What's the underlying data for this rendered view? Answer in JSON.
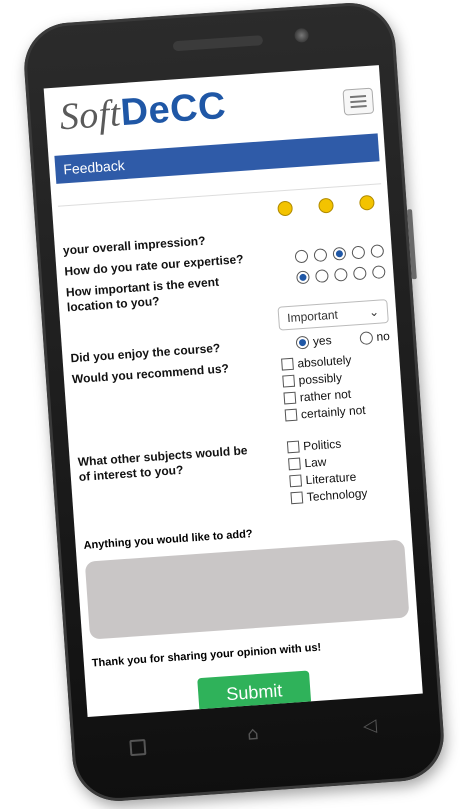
{
  "brand": {
    "soft": "Soft",
    "decc": "DeCC"
  },
  "menu": {
    "icon": "hamburger-icon"
  },
  "page": {
    "section_title": "Feedback"
  },
  "ratings": {
    "smileys": [
      "happy",
      "neutral",
      "sad"
    ]
  },
  "questions": {
    "overall": {
      "label": "your overall impression?"
    },
    "expertise": {
      "label": "How do you rate our expertise?",
      "selected_index": 2
    },
    "location": {
      "label": "How important is the event location to you?",
      "select_value": "Important",
      "selected_index": 0
    },
    "enjoy": {
      "label": "Did you enjoy the course?",
      "yes": "yes",
      "no": "no",
      "selected": "yes"
    },
    "recommend": {
      "label": "Would you recommend us?",
      "options": [
        "absolutely",
        "possibly",
        "rather not",
        "certainly not"
      ]
    },
    "subjects": {
      "label": "What other subjects would be of interest to you?",
      "options": [
        "Politics",
        "Law",
        "Literature",
        "Technology"
      ]
    },
    "add": {
      "label": "Anything you would like to add?"
    }
  },
  "footer": {
    "thanks": "Thank you for sharing your opinion with us!",
    "submit": "Submit"
  },
  "colors": {
    "brand_blue": "#2f5ba8",
    "submit_green": "#2fb25a",
    "textarea_gray": "#c9c6c6"
  }
}
